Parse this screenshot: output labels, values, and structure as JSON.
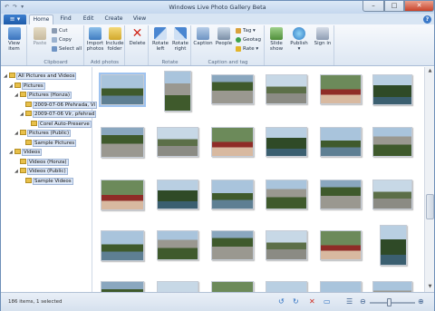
{
  "window": {
    "title": "Windows Live Photo Gallery Beta",
    "controls": {
      "minimize": "–",
      "maximize": "□",
      "close": "✕"
    },
    "quick_access": [
      "↶",
      "↷",
      "▾"
    ]
  },
  "tabs": {
    "file_label": "≡ ▾",
    "items": [
      "Home",
      "Find",
      "Edit",
      "Create",
      "View"
    ],
    "active": "Home",
    "help": "?"
  },
  "ribbon": {
    "groups": [
      {
        "label": ""
      },
      {
        "label": "Clipboard"
      },
      {
        "label": "Add photos"
      },
      {
        "label": ""
      },
      {
        "label": "Rotate"
      },
      {
        "label": "Caption and tag"
      },
      {
        "label": ""
      }
    ],
    "view_item": "View item",
    "paste": "Paste",
    "cut": "Cut",
    "copy": "Copy",
    "select_all": "Select all",
    "import_photos": "Import photos",
    "include_folder": "Include folder",
    "delete": "Delete",
    "rotate_left": "Rotate left",
    "rotate_right": "Rotate right",
    "caption": "Caption",
    "people": "People",
    "tag": "Tag ▾",
    "geotag": "Geotag",
    "rate": "Rate ▾",
    "slide_show": "Slide show",
    "publish": "Publish ▾",
    "sign_in": "Sign in"
  },
  "tree": [
    {
      "label": "All Pictures and Videos",
      "level": 0,
      "toggle": "◢"
    },
    {
      "label": "Pictures",
      "level": 1,
      "toggle": "◢"
    },
    {
      "label": "Pictures (Honza)",
      "level": 2,
      "toggle": "◢"
    },
    {
      "label": "2009-07-06 Přehrada, Vi",
      "level": 3,
      "toggle": ""
    },
    {
      "label": "2009-07-06 Vír, přehrad",
      "level": 3,
      "toggle": "◢"
    },
    {
      "label": "Corel Auto-Preserve",
      "level": 4,
      "toggle": ""
    },
    {
      "label": "Pictures (Public)",
      "level": 2,
      "toggle": "◢"
    },
    {
      "label": "Sample Pictures",
      "level": 3,
      "toggle": ""
    },
    {
      "label": "Videos",
      "level": 1,
      "toggle": "◢"
    },
    {
      "label": "Videos (Honza)",
      "level": 2,
      "toggle": ""
    },
    {
      "label": "Videos (Public)",
      "level": 2,
      "toggle": "◢"
    },
    {
      "label": "Sample Videos",
      "level": 3,
      "toggle": ""
    }
  ],
  "status": {
    "text": "186 items, 1 selected",
    "zoom_level": 0.42
  },
  "colors": {
    "sky": "#a9c4dc",
    "forest": "#3f5a2c",
    "water": "#5e7f93",
    "concrete": "#9a9890",
    "selection": "#dbe6f6"
  }
}
